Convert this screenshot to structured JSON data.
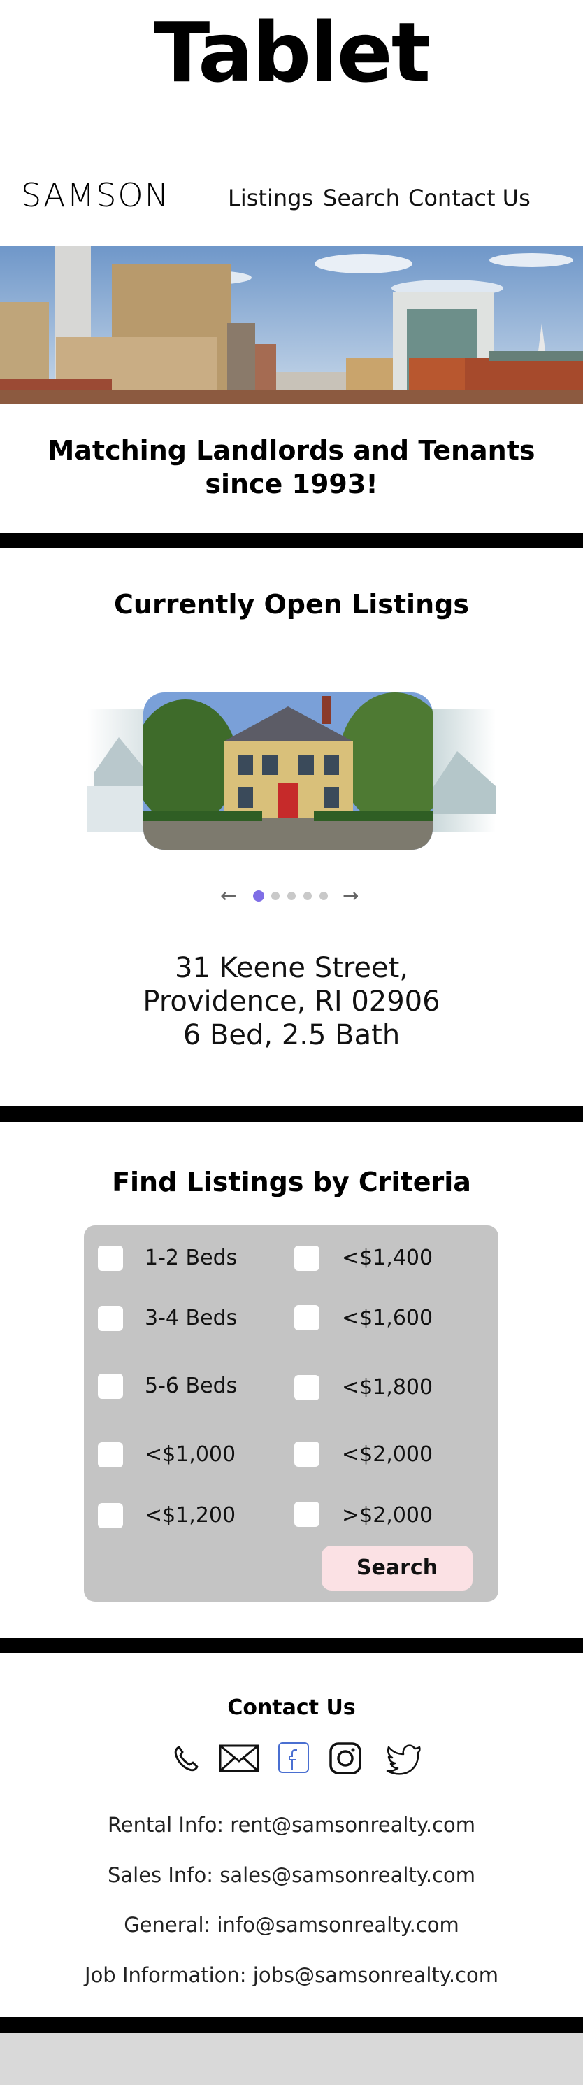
{
  "frame_title": "Tablet",
  "header": {
    "logo": "SAMSON",
    "nav": [
      "Listings",
      "Search",
      "Contact Us"
    ]
  },
  "hero": {
    "tagline_line1": "Matching Landlords and Tenants",
    "tagline_line2": "since 1993!"
  },
  "listings": {
    "title": "Currently Open Listings",
    "carousel": {
      "slide_count": 5,
      "active_index": 0,
      "prev_icon": "arrow-left-icon",
      "next_icon": "arrow-right-icon"
    },
    "address_line1": "31 Keene Street,",
    "address_line2": "Providence, RI 02906",
    "details": "6 Bed, 2.5 Bath"
  },
  "criteria": {
    "title": "Find Listings by Criteria",
    "left_options": [
      "1-2 Beds",
      "3-4 Beds",
      "5-6 Beds",
      "<$1,000",
      "<$1,200"
    ],
    "right_options": [
      "<$1,400",
      "<$1,600",
      "<$1,800",
      "<$2,000",
      ">$2,000"
    ],
    "search_label": "Search"
  },
  "contact": {
    "title": "Contact Us",
    "icons": [
      "phone-icon",
      "mail-icon",
      "facebook-icon",
      "instagram-icon",
      "twitter-icon"
    ],
    "rental": "Rental Info: rent@samsonrealty.com",
    "sales": "Sales Info: sales@samsonrealty.com",
    "general": "General: info@samsonrealty.com",
    "jobs": "Job Information: jobs@samsonrealty.com"
  },
  "colors": {
    "divider": "#000000",
    "criteria_box": "#c4c4c4",
    "search_button": "#fbe1e4",
    "active_dot": "#7f6ee6",
    "facebook": "#4a6fd1"
  }
}
